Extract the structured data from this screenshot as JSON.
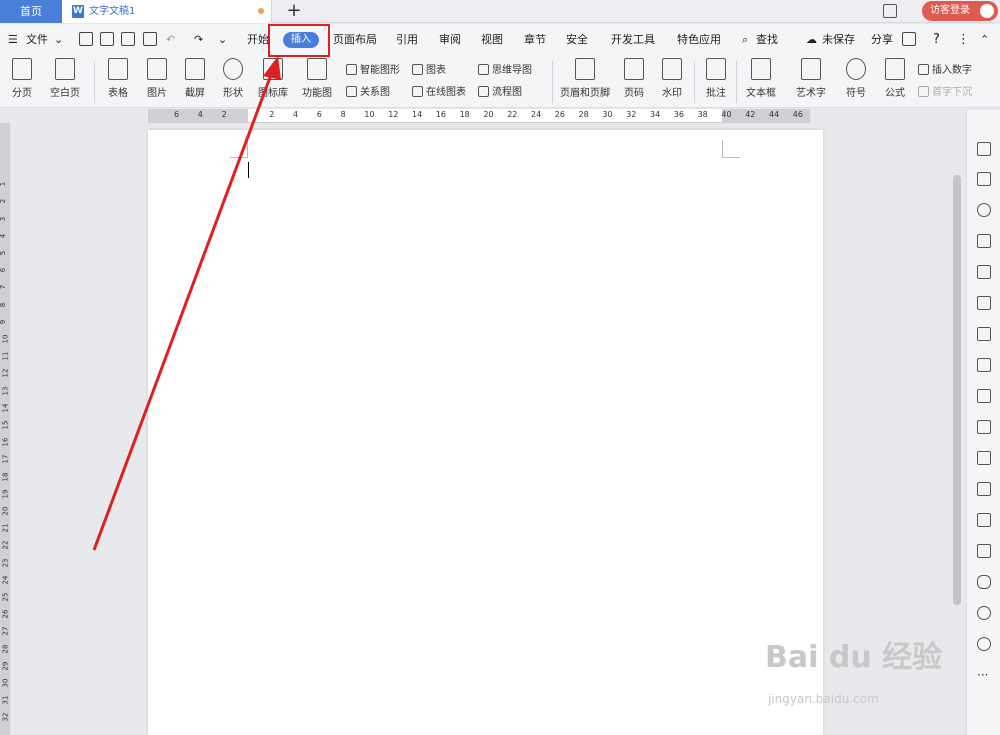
{
  "tabs": {
    "home": "首页",
    "doc_title": "文字文稿1",
    "add": "+"
  },
  "login": "访客登录",
  "menu": {
    "file": "文件",
    "items": [
      "开始",
      "插入",
      "页面布局",
      "引用",
      "审阅",
      "视图",
      "章节",
      "安全",
      "开发工具",
      "特色应用"
    ],
    "search": "查找",
    "unsaved": "未保存",
    "share": "分享",
    "help": "?",
    "more": "⋮"
  },
  "ribbon": {
    "pagebreak": "分页",
    "blankpage": "空白页",
    "table": "表格",
    "image": "图片",
    "screenshot": "截屏",
    "shape": "形状",
    "iconlib": "图标库",
    "funcmap": "功能图",
    "smartart": "智能图形",
    "relation": "关系图",
    "chart": "图表",
    "online_chart": "在线图表",
    "mindmap": "思维导图",
    "flowchart": "流程图",
    "header_footer": "页眉和页脚",
    "page_num": "页码",
    "watermark": "水印",
    "comment": "批注",
    "textbox": "文本框",
    "wordart": "艺术字",
    "symbol": "符号",
    "formula": "公式",
    "insert_num": "插入数字",
    "dropcap": "首字下沉"
  },
  "ruler": [
    "6",
    "4",
    "2",
    "",
    "2",
    "4",
    "6",
    "8",
    "10",
    "12",
    "14",
    "16",
    "18",
    "20",
    "22",
    "24",
    "26",
    "28",
    "30",
    "32",
    "34",
    "36",
    "38",
    "40",
    "42",
    "44",
    "46"
  ],
  "watermark": {
    "big": "Bai du 经验",
    "small": "jingyan.baidu.com"
  },
  "highlight_color": "#e02020",
  "accent_color": "#4a7fd9"
}
